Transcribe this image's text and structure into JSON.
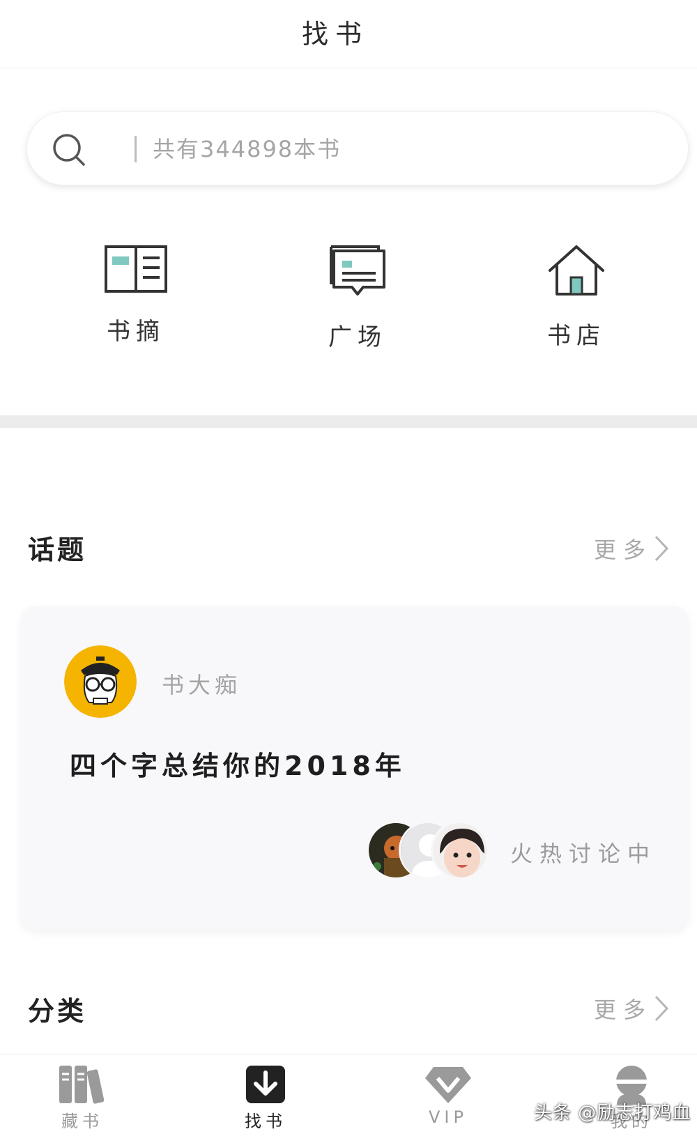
{
  "header": {
    "title": "找书"
  },
  "search": {
    "placeholder": "共有344898本书"
  },
  "quick_links": [
    {
      "label": "书摘",
      "icon": "open-book-icon"
    },
    {
      "label": "广场",
      "icon": "message-board-icon"
    },
    {
      "label": "书店",
      "icon": "house-icon"
    }
  ],
  "topics": {
    "title": "话题",
    "more_label": "更多",
    "card": {
      "author": "书大痴",
      "title": "四个字总结你的2018年",
      "status": "火热讨论中"
    }
  },
  "categories": {
    "title": "分类",
    "more_label": "更多"
  },
  "tabbar": {
    "items": [
      {
        "label": "藏书",
        "icon": "bookshelf-icon",
        "active": false
      },
      {
        "label": "找书",
        "icon": "download-book-icon",
        "active": true
      },
      {
        "label": "VIP",
        "icon": "diamond-icon",
        "active": false
      },
      {
        "label": "我的",
        "icon": "profile-icon",
        "active": false
      }
    ]
  },
  "watermark": "头条 @励志打鸡血",
  "colors": {
    "accent_teal": "#7fc9c0",
    "icon_dark": "#333333",
    "avatar_yellow": "#f5b400",
    "divider_gray": "#ececec"
  }
}
